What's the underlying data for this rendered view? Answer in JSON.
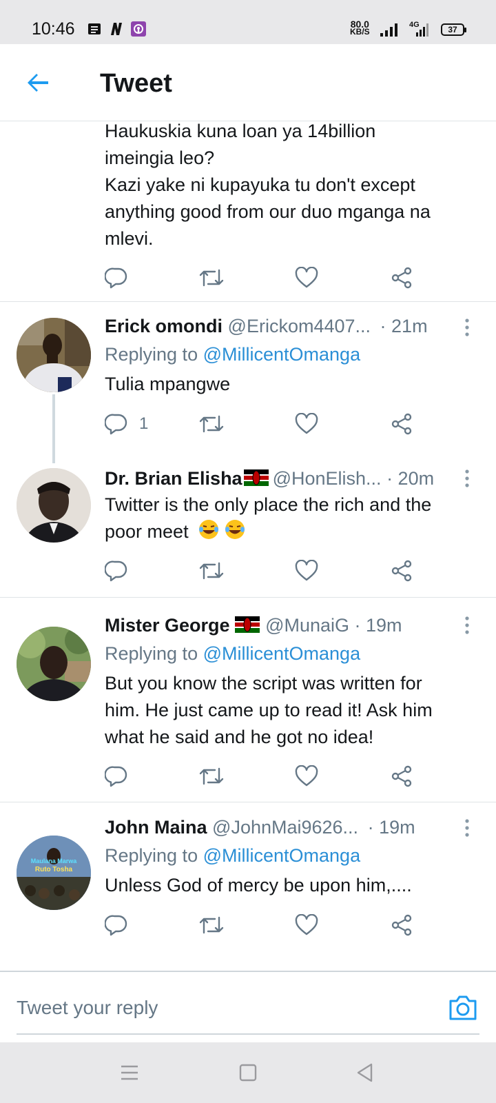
{
  "status_bar": {
    "time": "10:46",
    "net_speed_value": "80.0",
    "net_speed_unit": "KB/S",
    "network_type": "4G",
    "battery": "37"
  },
  "header": {
    "title": "Tweet"
  },
  "top_tweet": {
    "text_lines": [
      "Haukuskia kuna loan ya 14billion",
      "imeingia leo?",
      "Kazi yake ni kupayuka tu don't except",
      "anything good from our duo mganga na",
      "mlevi."
    ]
  },
  "tweets": [
    {
      "author": "Erick omondi",
      "handle": "@Erickom4407...",
      "time": "· 21m",
      "replying_prefix": "Replying to",
      "replying_to": "@MillicentOmanga",
      "text": "Tulia mpangwe",
      "reply_count": "1"
    },
    {
      "author": "Dr. Brian Elisha",
      "handle": "@HonElish...",
      "time": "· 20m",
      "text_line1": "Twitter is the only place the rich and the",
      "text_line2": "poor meet"
    },
    {
      "author": "Mister George ",
      "handle": "@MunaiG",
      "time": "· 19m",
      "replying_prefix": "Replying to",
      "replying_to": "@MillicentOmanga",
      "text_lines": [
        "But you know the script was written for",
        "him. He just came up to read it! Ask him",
        "what he said and he got no idea!"
      ]
    },
    {
      "author": "John Maina",
      "handle": "@JohnMai9626...",
      "time": "· 19m",
      "replying_prefix": "Replying to",
      "replying_to": "@MillicentOmanga",
      "text": "Unless God of mercy be upon him,....",
      "avatar_banner_line1": "Maulana Marwa",
      "avatar_banner_line2": "Ruto Tosha"
    }
  ],
  "reply_bar": {
    "placeholder": "Tweet your reply"
  },
  "colors": {
    "accent": "#1d9bf0",
    "mention": "#2b8fd6",
    "secondary_text": "#657786",
    "icon_gray": "#657786"
  },
  "icons": {
    "reply": "reply-icon",
    "retweet": "retweet-icon",
    "like": "heart-icon",
    "share": "share-icon",
    "more": "more-vertical-icon",
    "back": "arrow-left-icon",
    "camera": "camera-icon"
  }
}
